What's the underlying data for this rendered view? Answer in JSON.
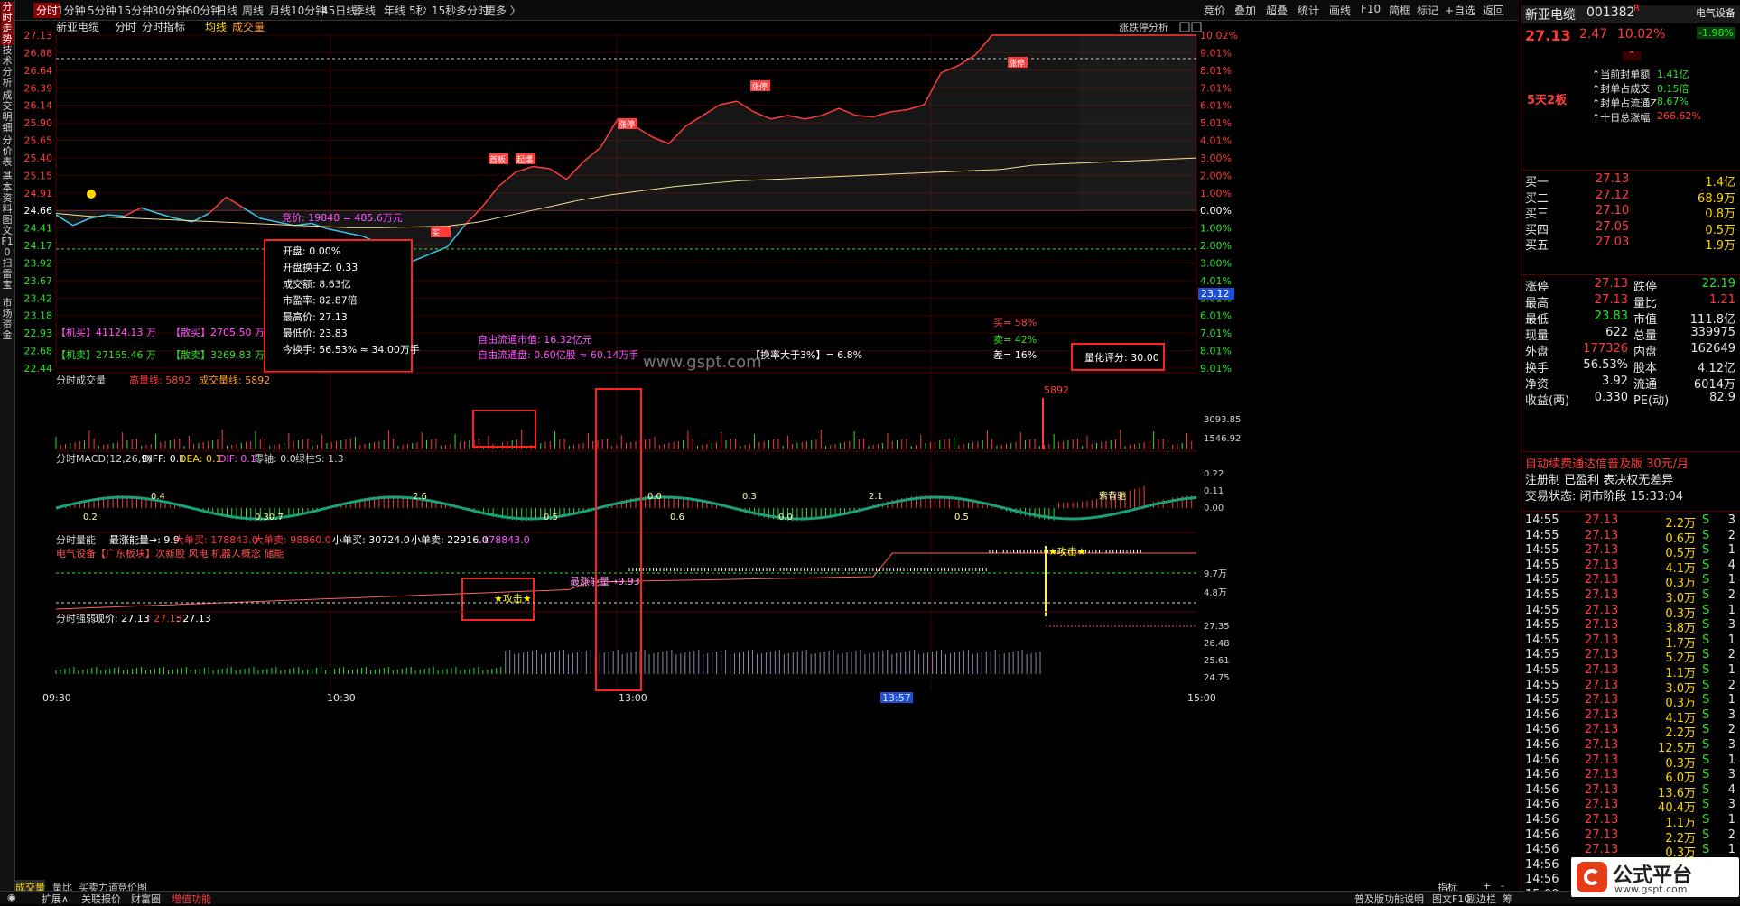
{
  "left_tabs": [
    "分时走势",
    "技术分析",
    "成交明细",
    "分价表",
    "基本资料",
    "图文F10",
    "扫雷宝",
    "市场资金"
  ],
  "toolbar": {
    "periods": [
      "分时",
      "1分钟",
      "5分钟",
      "15分钟",
      "30分钟",
      "60分钟",
      "日线",
      "周线",
      "月线",
      "10分钟",
      "45日线",
      "季线",
      "年线",
      "5秒",
      "15秒",
      "多分时",
      "更多 〉"
    ],
    "right": [
      "竞价",
      "叠加",
      "超叠",
      "统计",
      "画线",
      "F10",
      "简框",
      "标记",
      "+自选",
      "返回"
    ]
  },
  "chart_header": {
    "title": "新亚电缆",
    "items": [
      "分时",
      "分时指标",
      "均线",
      "成交量"
    ],
    "right": "涨跌停分析"
  },
  "price_axis_left": [
    "27.13",
    "26.88",
    "26.64",
    "26.39",
    "26.14",
    "25.90",
    "25.65",
    "25.40",
    "25.15",
    "24.91",
    "24.66",
    "24.41",
    "24.17",
    "23.92",
    "23.67",
    "23.42",
    "23.18",
    "22.93",
    "22.68",
    "22.44"
  ],
  "pct_axis_right": [
    "10.02%",
    "9.01%",
    "8.01%",
    "7.01%",
    "6.01%",
    "5.01%",
    "4.01%",
    "3.00%",
    "2.00%",
    "1.00%",
    "0.00%",
    "1.00%",
    "2.00%",
    "3.00%",
    "4.01%",
    "5.01%",
    "6.01%",
    "7.01%",
    "8.01%",
    "9.01%"
  ],
  "price_tag": "23.12",
  "chart_data": {
    "type": "line",
    "x_ticks": [
      "09:30",
      "10:30",
      "13:00",
      "13:57",
      "15:00"
    ],
    "prev_close": 24.66,
    "price": [
      24.6,
      24.45,
      24.55,
      24.6,
      24.58,
      24.7,
      24.62,
      24.55,
      24.5,
      24.62,
      24.85,
      24.7,
      24.55,
      24.5,
      24.45,
      24.48,
      24.4,
      24.35,
      24.3,
      24.2,
      24.0,
      23.95,
      24.05,
      24.15,
      24.45,
      24.7,
      25.0,
      25.2,
      25.28,
      25.25,
      25.1,
      25.35,
      25.55,
      25.95,
      25.85,
      25.7,
      25.6,
      25.85,
      26.0,
      26.15,
      26.2,
      26.05,
      25.95,
      26.0,
      25.95,
      26.0,
      26.1,
      26.0,
      25.98,
      26.05,
      26.08,
      26.15,
      26.6,
      26.7,
      26.85,
      27.13,
      27.13,
      27.13,
      27.13,
      27.13,
      27.13
    ],
    "avg": [
      24.62,
      24.58,
      24.56,
      24.54,
      24.52,
      24.5,
      24.48,
      24.46,
      24.44,
      24.42,
      24.42,
      24.43,
      24.44,
      24.5,
      24.6,
      24.7,
      24.8,
      24.88,
      24.94,
      25.0,
      25.04,
      25.08,
      25.1,
      25.12,
      25.14,
      25.16,
      25.18,
      25.2,
      25.22,
      25.24,
      25.3,
      25.32,
      25.34,
      25.36,
      25.38,
      25.4
    ],
    "macd_yaxis": [
      "0.22",
      "0.11",
      "0.00"
    ],
    "vol_yaxis": [
      "3093.85",
      "1546.92"
    ],
    "energy_yaxis": [
      "9.7万",
      "4.8万"
    ],
    "strength_yaxis": [
      "27.35",
      "26.48",
      "25.61",
      "24.75"
    ]
  },
  "overlay": {
    "bid_label": "竞价: 19848 = 485.6万元",
    "box": [
      "开盘: 0.00%",
      "开盘换手Z: 0.33",
      "成交额: 8.63亿",
      "市盈率: 82.87倍",
      "最高价: 27.13",
      "最低价: 23.83",
      "今换手: 56.53% ≈ 34.00万手"
    ],
    "jimai": "【机买】41124.13 万",
    "sanmai": "【散买】2705.50 万",
    "jimai2": "【机卖】27165.46 万",
    "sanmai2": "【散卖】3269.83 万",
    "free_mv": "自由流通市值: 16.32亿元",
    "free_share": "自由流通盘: 0.60亿股 ≈ 60.14万手",
    "fill_rate": "【换率大于3%】= 6.8%",
    "buy_pct": "买= 58%",
    "sell_pct": "卖= 42%",
    "diff_pct": "差= 16%",
    "score": "量化评分: 30.00",
    "watermark": "www.gspt.com",
    "tags": [
      "首板",
      "起爆",
      "涨停",
      "买",
      "卖"
    ]
  },
  "panels": {
    "vol": {
      "title": "分时成交量",
      "a": "高量线: 5892",
      "b": "成交量线: 5892",
      "peak": "5892"
    },
    "macd": {
      "title": "分时MACD(12,26,9)",
      "diff": "DIFF: 0.1",
      "dea": "DEA: 0.1",
      "dif2": "DIF: 0.1",
      "zero": "零轴: 0.0",
      "bar": "绿柱S: 1.3",
      "labels": [
        "0.2",
        "0.4",
        "0.30.7",
        "2.6",
        "0.5",
        "0.0",
        "0.6",
        "0.3",
        "0.0",
        "2.1",
        "0.5",
        "紫背驰"
      ]
    },
    "energy": {
      "title": "分时量能",
      "a": "最涨能量→: 9.9",
      "b": "大单买: 178843.0",
      "c": "大单卖: 98860.0",
      "d": "小单买: 30724.0",
      "e": "小单卖: 22916.0",
      "f": ": 178843.0",
      "sector": "电气设备【广东板块】次新股 风电 机器人概念 储能",
      "attack": "★攻击★",
      "energy_lbl": "最涨能量→9.93"
    },
    "strength": {
      "title": "分时强弱",
      "a": "现价: 27.13",
      "b": ": 27.13",
      "c": ": 27.13"
    }
  },
  "stock": {
    "name": "新亚电缆",
    "code": "001382",
    "mark": "R",
    "industry": "电气设备",
    "price": "27.13",
    "change": "2.47",
    "pct": "10.02%",
    "ind_pct": "-1.98%",
    "streak": "5天2板",
    "seal": [
      [
        "当前封单额",
        "1.41亿"
      ],
      [
        "封单占成交",
        "0.15倍"
      ],
      [
        "封单占流通Z",
        "8.67%"
      ],
      [
        "十日总涨幅",
        "266.62%"
      ]
    ],
    "bids": [
      [
        "买一",
        "27.13",
        "1.4亿"
      ],
      [
        "买二",
        "27.12",
        "68.9万"
      ],
      [
        "买三",
        "27.10",
        "0.8万"
      ],
      [
        "买四",
        "27.05",
        "0.5万"
      ],
      [
        "买五",
        "27.03",
        "1.9万"
      ]
    ],
    "stats": [
      [
        "涨停",
        "27.13",
        "跌停",
        "22.19"
      ],
      [
        "最高",
        "27.13",
        "量比",
        "1.21"
      ],
      [
        "最低",
        "23.83",
        "市值",
        "111.8亿"
      ],
      [
        "现量",
        "622",
        "总量",
        "339975"
      ],
      [
        "外盘",
        "177326",
        "内盘",
        "162649"
      ],
      [
        "换手",
        "56.53%",
        "股本",
        "4.12亿"
      ],
      [
        "净资",
        "3.92",
        "流通",
        "6014万"
      ],
      [
        "收益(两)",
        "0.330",
        "PE(动)",
        "82.9"
      ]
    ],
    "notes": [
      "自动续费通达信普及版    30元/月",
      "注册制  已盈利  表决权无差异",
      "交易状态: 闭市阶段 15:33:04"
    ],
    "ticks": [
      [
        "14:55",
        "27.13",
        "2.2万",
        "S",
        "3"
      ],
      [
        "14:55",
        "27.13",
        "0.6万",
        "S",
        "2"
      ],
      [
        "14:55",
        "27.13",
        "0.5万",
        "S",
        "1"
      ],
      [
        "14:55",
        "27.13",
        "4.1万",
        "S",
        "4"
      ],
      [
        "14:55",
        "27.13",
        "0.3万",
        "S",
        "1"
      ],
      [
        "14:55",
        "27.13",
        "3.0万",
        "S",
        "2"
      ],
      [
        "14:55",
        "27.13",
        "0.3万",
        "S",
        "1"
      ],
      [
        "14:55",
        "27.13",
        "3.8万",
        "S",
        "3"
      ],
      [
        "14:55",
        "27.13",
        "1.7万",
        "S",
        "1"
      ],
      [
        "14:55",
        "27.13",
        "5.2万",
        "S",
        "2"
      ],
      [
        "14:55",
        "27.13",
        "1.1万",
        "S",
        "1"
      ],
      [
        "14:55",
        "27.13",
        "3.0万",
        "S",
        "2"
      ],
      [
        "14:55",
        "27.13",
        "0.3万",
        "S",
        "1"
      ],
      [
        "14:56",
        "27.13",
        "4.1万",
        "S",
        "3"
      ],
      [
        "14:56",
        "27.13",
        "2.2万",
        "S",
        "2"
      ],
      [
        "14:56",
        "27.13",
        "12.5万",
        "S",
        "3"
      ],
      [
        "14:56",
        "27.13",
        "0.3万",
        "S",
        "1"
      ],
      [
        "14:56",
        "27.13",
        "6.0万",
        "S",
        "3"
      ],
      [
        "14:56",
        "27.13",
        "13.6万",
        "S",
        "4"
      ],
      [
        "14:56",
        "27.13",
        "40.4万",
        "S",
        "3"
      ],
      [
        "14:56",
        "27.13",
        "1.1万",
        "S",
        "1"
      ],
      [
        "14:56",
        "27.13",
        "2.2万",
        "S",
        "2"
      ],
      [
        "14:56",
        "27.13",
        "0.3万",
        "S",
        "1"
      ],
      [
        "14:56",
        "27.13",
        "1.4万",
        "S",
        "1"
      ],
      [
        "14:56",
        "27.13",
        "0.5万",
        "S",
        "1"
      ],
      [
        "15:00",
        "27.13",
        "",
        "",
        ""
      ]
    ]
  },
  "bottom": {
    "tabs1": [
      "成交量",
      "量比",
      "买卖力道",
      "竞价图"
    ],
    "right1": [
      "指标",
      "+",
      "-"
    ],
    "tabs2": [
      "扩展∧",
      "关联报价",
      "财富圈",
      "增值功能"
    ],
    "right2": [
      "普及版功能说明",
      "图文F10",
      "副边栏",
      "筹"
    ],
    "logo": "公式平台",
    "logo_url": "www.gspt.com"
  }
}
